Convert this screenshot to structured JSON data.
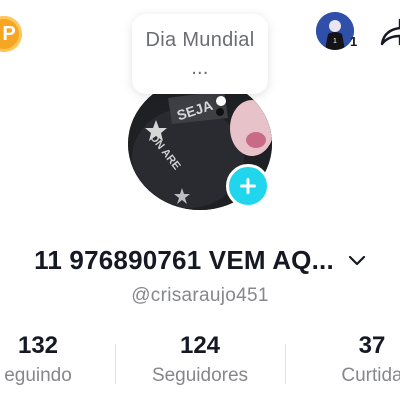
{
  "note": {
    "text": "Dia Mundial ..."
  },
  "header": {
    "coin_badge_glyph": "P",
    "friend_count": "1"
  },
  "profile": {
    "display_name": "11 976890761 VEM AQ...",
    "username": "@crisaraujo451"
  },
  "stats": [
    {
      "value": "132",
      "label": "eguindo"
    },
    {
      "value": "124",
      "label": "Seguidores"
    },
    {
      "value": "37",
      "label": "Curtida"
    }
  ],
  "icons": {
    "coin": "coin-badge-icon",
    "share": "share-icon",
    "add": "plus-icon",
    "dropdown": "chevron-down-icon"
  },
  "colors": {
    "accent": "#20d5ec",
    "badge": "#f6a623",
    "text_primary": "#161823",
    "text_secondary": "#86878b"
  }
}
